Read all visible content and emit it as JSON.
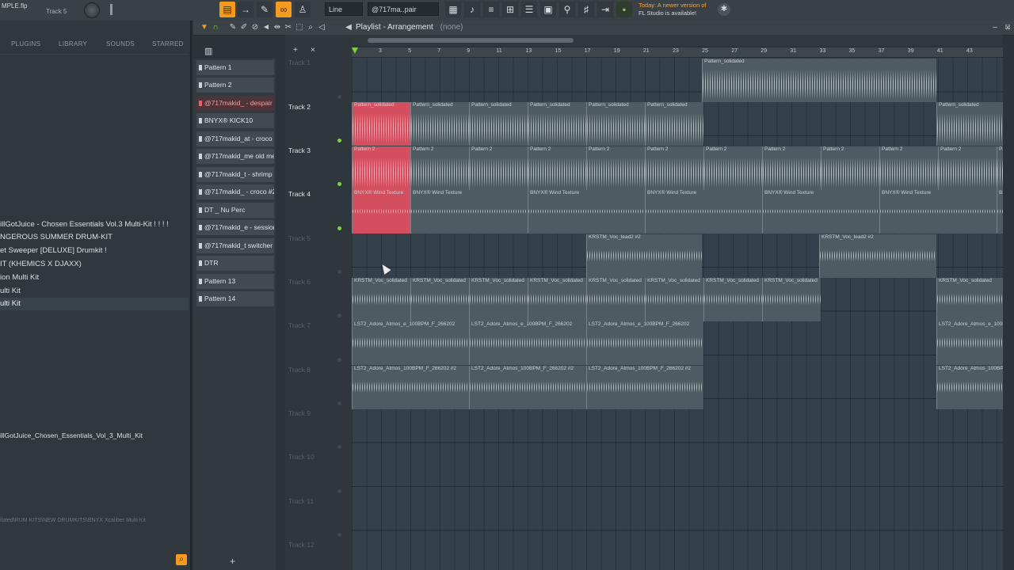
{
  "topbar": {
    "file_name": "MPLE.flp",
    "track_hint": "Track 5",
    "snap_mode": "Line",
    "pattern_selector": "@717ma..pair",
    "news_line1": "Today: A newer version of",
    "news_line2": "FL Studio is available!"
  },
  "browser": {
    "tabs": [
      "PLUGINS",
      "LIBRARY",
      "SOUNDS",
      "STARRED"
    ],
    "items": [
      "illGotJuice - Chosen Essentials Vol.3 Multi-Kit ! ! ! !",
      "NGEROUS SUMMER DRUM-KIT",
      "et Sweeper [DELUXE] Drumkit !",
      "IT (KHEMICS X DJAXX)",
      "ion Multi Kit",
      "ulti Kit",
      "ulti Kit"
    ],
    "selected_path": "illGotJuice_Chosen_Essentials_Vol_3_Multi_Kit",
    "footer_path": "ilated\\RUM KITS\\NEW DRUMKITS\\BNYX Xcaliber Multi Kit"
  },
  "patterns": [
    "Pattern 1",
    "Pattern 2",
    "@717makid_ - despair",
    "BNYX® KICK10",
    "@717makid_at - croco",
    "@717makid_me old me",
    "@717makid_t - shrimp",
    "@717makid_ - croco #2",
    "DT _ Nu Perc",
    "@717makid_e - session",
    "@717makid_t switcher",
    "DTR",
    "Pattern 13",
    "Pattern 14"
  ],
  "playlist": {
    "title": "Playlist - Arrangement",
    "arrangement": "(none)",
    "ruler": [
      "3",
      "5",
      "7",
      "9",
      "11",
      "13",
      "15",
      "17",
      "19",
      "21",
      "23",
      "25",
      "27",
      "29",
      "31",
      "33",
      "35",
      "37",
      "39",
      "41",
      "43"
    ],
    "tracks": [
      {
        "name": "Track 1",
        "active": false
      },
      {
        "name": "Track 2",
        "active": true
      },
      {
        "name": "Track 3",
        "active": true
      },
      {
        "name": "Track 4",
        "active": true
      },
      {
        "name": "Track 5",
        "active": false
      },
      {
        "name": "Track 6",
        "active": false
      },
      {
        "name": "Track 7",
        "active": false
      },
      {
        "name": "Track 8",
        "active": false
      },
      {
        "name": "Track 9",
        "active": false
      },
      {
        "name": "Track 10",
        "active": false
      },
      {
        "name": "Track 11",
        "active": false
      },
      {
        "name": "Track 12",
        "active": false
      }
    ],
    "clip_labels": {
      "pattern_solidated": "Pattern_solidated",
      "pattern_2": "Pattern 2",
      "wind_texture": "BNYX® Wind Texture",
      "voc": "KRSTM_Voc_lead2 #2",
      "voc_solid": "KRSTM_Voc_solidated",
      "ambient1": "LST2_Adore_Atmos_e_100BPM_F_266202",
      "ambient2": "LST2_Adore_Atmos_100BPM_F_266202 #2"
    }
  },
  "colors": {
    "accent": "#f39a1f",
    "clip_red": "#d34f5f",
    "clip_default": "#4f5b62",
    "led_on": "#7bd33a"
  }
}
